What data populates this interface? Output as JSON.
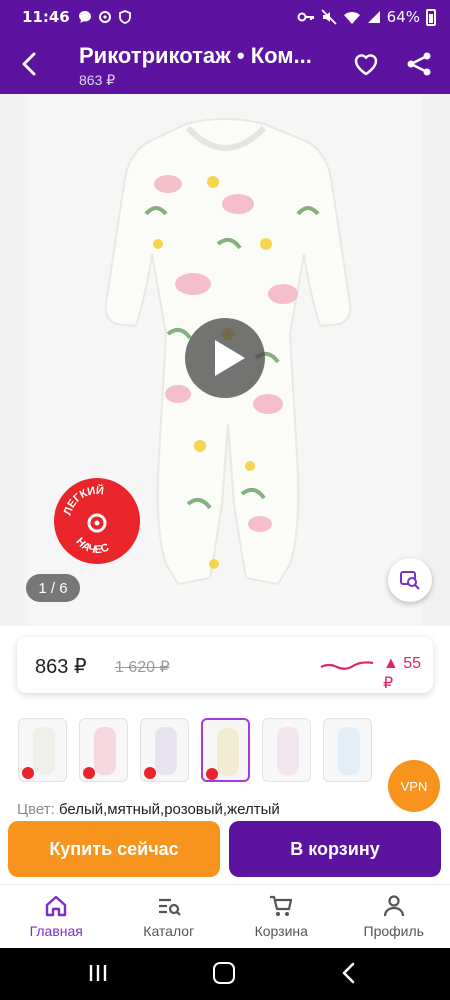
{
  "status_bar": {
    "time": "11:46",
    "battery": "64%"
  },
  "app_bar": {
    "title": "Рикотрикотаж • Ком...",
    "subtitle": "863 ₽"
  },
  "gallery": {
    "counter": "1 / 6",
    "badge_text": "ЛЕГКИЙ НАЧЕС"
  },
  "price_card": {
    "price": "863 ₽",
    "old_price": "1 620 ₽",
    "delta": "▲ 55 ₽",
    "accent": "#e0245e"
  },
  "thumbnails": [
    {
      "color": "#eef1ea",
      "selected": false
    },
    {
      "color": "#f6d6df",
      "selected": false
    },
    {
      "color": "#e9e2ef",
      "selected": false
    },
    {
      "color": "#f2ecd3",
      "selected": true
    },
    {
      "color": "#f3e6ee",
      "selected": false
    },
    {
      "color": "#e4eef6",
      "selected": false
    }
  ],
  "vpn_label": "VPN",
  "color_line": {
    "label": "Цвет:",
    "value": "белый,мятный,розовый,желтый"
  },
  "buttons": {
    "buy_now": "Купить сейчас",
    "add_to_cart": "В корзину"
  },
  "bottom_nav": {
    "items": [
      {
        "label": "Главная",
        "icon": "home-icon",
        "active": true
      },
      {
        "label": "Каталог",
        "icon": "catalog-search-icon",
        "active": false
      },
      {
        "label": "Корзина",
        "icon": "cart-icon",
        "active": false
      },
      {
        "label": "Профиль",
        "icon": "profile-icon",
        "active": false
      }
    ]
  },
  "colors": {
    "brand_purple": "#5b13a0",
    "accent_orange": "#f7941d",
    "active_nav": "#7b2fc7"
  }
}
